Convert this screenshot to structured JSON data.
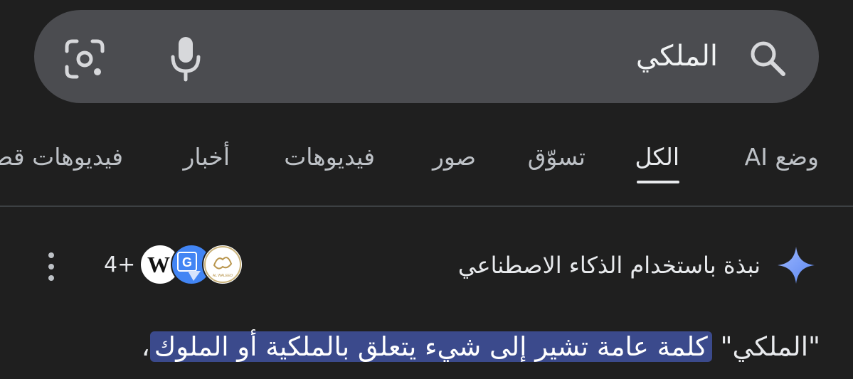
{
  "search": {
    "query": "الملكي"
  },
  "tabs": [
    {
      "label": "وضع AI",
      "active": false
    },
    {
      "label": "الكل",
      "active": true
    },
    {
      "label": "تسوّق",
      "active": false
    },
    {
      "label": "صور",
      "active": false
    },
    {
      "label": "فيديوهات",
      "active": false
    },
    {
      "label": "أخبار",
      "active": false
    },
    {
      "label": "فيديوهات قصيرة",
      "active": false
    }
  ],
  "ai_overview": {
    "title": "نبذة باستخدام الذكاء الاصطناعي",
    "sources": [
      {
        "name": "Wikipedia",
        "label": "W"
      },
      {
        "name": "Google Translate",
        "label": "G"
      },
      {
        "name": "Al Waleed",
        "label": "AL WALEED"
      }
    ],
    "more_sources": "4+",
    "snippet_quote": "\"الملكي\"",
    "snippet_highlight": "كلمة عامة تشير إلى شيء يتعلق بالملكية أو الملوك",
    "snippet_tail": "،"
  },
  "colors": {
    "background": "#1f1f1f",
    "search_bar": "#4b4c50",
    "highlight": "#3b4a8c",
    "sparkle": "#7aa2f7"
  }
}
